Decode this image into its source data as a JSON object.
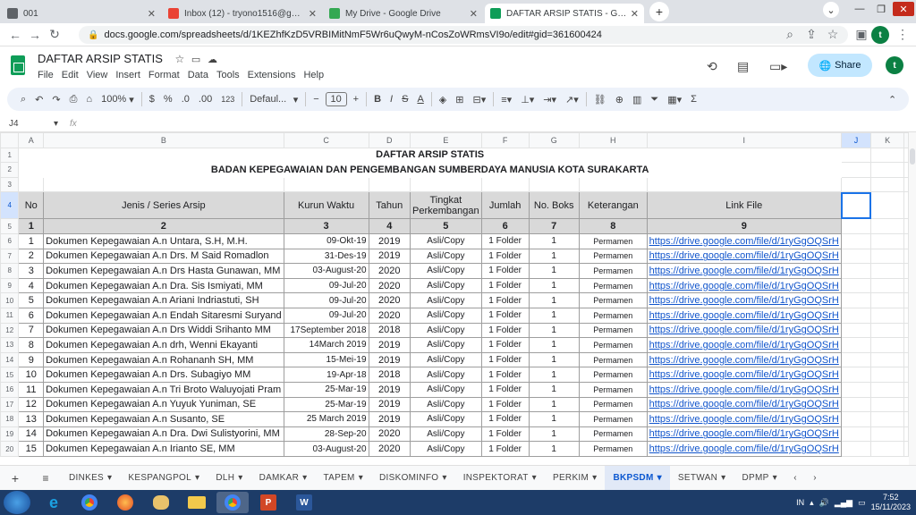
{
  "browser": {
    "tabs": [
      {
        "title": "001",
        "color": "#5f6368"
      },
      {
        "title": "Inbox (12) - tryono1516@gmail.c",
        "color": "#ea4335"
      },
      {
        "title": "My Drive - Google Drive",
        "color": "#34a853"
      },
      {
        "title": "DAFTAR ARSIP STATIS - Google S",
        "color": "#0f9d58"
      }
    ],
    "url": "docs.google.com/spreadsheets/d/1KEZhfKzD5VRBIMitNmF5Wr6uQwyM-nCosZoWRmsVI9o/edit#gid=361600424",
    "profile_initial": "t"
  },
  "app": {
    "doc_title": "DAFTAR ARSIP STATIS",
    "menus": [
      "File",
      "Edit",
      "View",
      "Insert",
      "Format",
      "Data",
      "Tools",
      "Extensions",
      "Help"
    ],
    "share_label": "Share",
    "user_initial": "t"
  },
  "toolbar": {
    "zoom": "100%",
    "currency": "$",
    "percent": "%",
    "dec_decrease": ".0",
    "dec_increase": ".00",
    "number_format": "123",
    "font": "Defaul...",
    "font_size": "10",
    "bold": "B",
    "italic": "I",
    "strike": "S",
    "text_color": "A"
  },
  "formula_bar": {
    "cell_ref": "J4",
    "fx": "fx"
  },
  "grid": {
    "columns": [
      "A",
      "B",
      "C",
      "D",
      "E",
      "F",
      "G",
      "H",
      "I",
      "J",
      "K"
    ],
    "selected_column": "J",
    "title1": "DAFTAR ARSIP STATIS",
    "title2": "BADAN KEPEGAWAIAN DAN PENGEMBANGAN SUMBERDAYA  MANUSIA KOTA SURAKARTA",
    "headers": [
      "No",
      "Jenis / Series Arsip",
      "Kurun Waktu",
      "Tahun",
      "Tingkat Perkembangan",
      "Jumlah",
      "No. Boks",
      "Keterangan",
      "Link File"
    ],
    "header_numbers": [
      "1",
      "2",
      "3",
      "4",
      "5",
      "6",
      "7",
      "8",
      "9"
    ],
    "rows": [
      {
        "no": "1",
        "jenis": "Dokumen Kepegawaian A.n Untara, S.H, M.H.",
        "kurun": "09-Okt-19",
        "tahun": "2019",
        "tingkat": "Asli/Copy",
        "jumlah": "1 Folder",
        "boks": "1",
        "ket": "Permamen",
        "link": "https://drive.google.com/file/d/1ryGgOQSrH"
      },
      {
        "no": "2",
        "jenis": "Dokumen Kepegawaian A.n Drs. M Said Romadlon",
        "kurun": "31-Des-19",
        "tahun": "2019",
        "tingkat": "Asli/Copy",
        "jumlah": "1 Folder",
        "boks": "1",
        "ket": "Permamen",
        "link": "https://drive.google.com/file/d/1ryGgOQSrH"
      },
      {
        "no": "3",
        "jenis": "Dokumen Kepegawaian A.n Drs Hasta Gunawan, MM",
        "kurun": "03-August-20",
        "tahun": "2020",
        "tingkat": "Asli/Copy",
        "jumlah": "1 Folder",
        "boks": "1",
        "ket": "Permamen",
        "link": "https://drive.google.com/file/d/1ryGgOQSrH"
      },
      {
        "no": "4",
        "jenis": "Dokumen Kepegawaian A.n Dra. Sis Ismiyati, MM",
        "kurun": "09-Jul-20",
        "tahun": "2020",
        "tingkat": "Asli/Copy",
        "jumlah": "1 Folder",
        "boks": "1",
        "ket": "Permamen",
        "link": "https://drive.google.com/file/d/1ryGgOQSrH"
      },
      {
        "no": "5",
        "jenis": "Dokumen Kepegawaian A.n Ariani Indriastuti, SH",
        "kurun": "09-Jul-20",
        "tahun": "2020",
        "tingkat": "Asli/Copy",
        "jumlah": "1 Folder",
        "boks": "1",
        "ket": "Permamen",
        "link": "https://drive.google.com/file/d/1ryGgOQSrH"
      },
      {
        "no": "6",
        "jenis": "Dokumen Kepegawaian A.n Endah Sitaresmi Suryand",
        "kurun": "09-Jul-20",
        "tahun": "2020",
        "tingkat": "Asli/Copy",
        "jumlah": "1 Folder",
        "boks": "1",
        "ket": "Permamen",
        "link": "https://drive.google.com/file/d/1ryGgOQSrH"
      },
      {
        "no": "7",
        "jenis": "Dokumen Kepegawaian A.n Drs Widdi Srihanto MM",
        "kurun": "17September 2018",
        "tahun": "2018",
        "tingkat": "Asli/Copy",
        "jumlah": "1 Folder",
        "boks": "1",
        "ket": "Permamen",
        "link": "https://drive.google.com/file/d/1ryGgOQSrH"
      },
      {
        "no": "8",
        "jenis": "Dokumen Kepegawaian A.n drh, Wenni Ekayanti",
        "kurun": "14March 2019",
        "tahun": "2019",
        "tingkat": "Asli/Copy",
        "jumlah": "1 Folder",
        "boks": "1",
        "ket": "Permamen",
        "link": "https://drive.google.com/file/d/1ryGgOQSrH"
      },
      {
        "no": "9",
        "jenis": "Dokumen Kepegawaian A.n Rohananh SH, MM",
        "kurun": "15-Mei-19",
        "tahun": "2019",
        "tingkat": "Asli/Copy",
        "jumlah": "1 Folder",
        "boks": "1",
        "ket": "Permamen",
        "link": "https://drive.google.com/file/d/1ryGgOQSrH"
      },
      {
        "no": "10",
        "jenis": "Dokumen Kepegawaian A.n Drs. Subagiyo MM",
        "kurun": "19-Apr-18",
        "tahun": "2018",
        "tingkat": "Asli/Copy",
        "jumlah": "1 Folder",
        "boks": "1",
        "ket": "Permamen",
        "link": "https://drive.google.com/file/d/1ryGgOQSrH"
      },
      {
        "no": "11",
        "jenis": "Dokumen Kepegawaian A.n Tri Broto Waluyojati Pram",
        "kurun": "25-Mar-19",
        "tahun": "2019",
        "tingkat": "Asli/Copy",
        "jumlah": "1 Folder",
        "boks": "1",
        "ket": "Permamen",
        "link": "https://drive.google.com/file/d/1ryGgOQSrH"
      },
      {
        "no": "12",
        "jenis": "Dokumen Kepegawaian A.n Yuyuk Yuniman, SE",
        "kurun": "25-Mar-19",
        "tahun": "2019",
        "tingkat": "Asli/Copy",
        "jumlah": "1 Folder",
        "boks": "1",
        "ket": "Permamen",
        "link": "https://drive.google.com/file/d/1ryGgOQSrH"
      },
      {
        "no": "13",
        "jenis": "Dokumen Kepegawaian A.n Susanto, SE",
        "kurun": "25 March 2019",
        "tahun": "2019",
        "tingkat": "Asli/Copy",
        "jumlah": "1 Folder",
        "boks": "1",
        "ket": "Permamen",
        "link": "https://drive.google.com/file/d/1ryGgOQSrH"
      },
      {
        "no": "14",
        "jenis": "Dokumen Kepegawaian A.n Dra. Dwi Sulistyorini, MM",
        "kurun": "28-Sep-20",
        "tahun": "2020",
        "tingkat": "Asli/Copy",
        "jumlah": "1 Folder",
        "boks": "1",
        "ket": "Permamen",
        "link": "https://drive.google.com/file/d/1ryGgOQSrH"
      },
      {
        "no": "15",
        "jenis": "Dokumen Kepegawaian A.n Irianto SE, MM",
        "kurun": "03-August-20",
        "tahun": "2020",
        "tingkat": "Asli/Copy",
        "jumlah": "1 Folder",
        "boks": "1",
        "ket": "Permamen",
        "link": "https://drive.google.com/file/d/1ryGgOQSrH"
      }
    ]
  },
  "sheets": {
    "tabs": [
      "DINKES",
      "KESPANGPOL",
      "DLH",
      "DAMKAR",
      "TAPEM",
      "DISKOMINFO",
      "INSPEKTORAT",
      "PERKIM",
      "BKPSDM",
      "SETWAN",
      "DPMP"
    ],
    "active": "BKPSDM"
  },
  "taskbar": {
    "lang": "IN",
    "time": "7:52",
    "date": "15/11/2023"
  }
}
